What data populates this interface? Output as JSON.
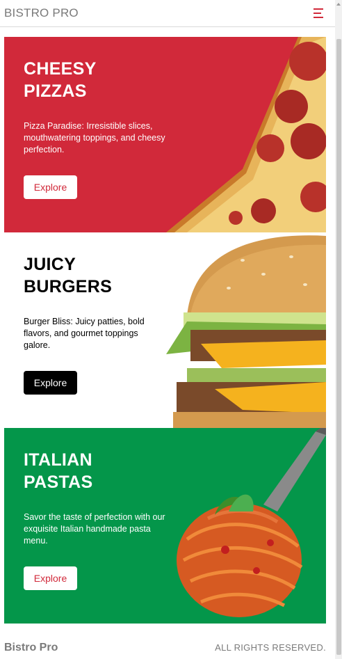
{
  "header": {
    "brand": "BISTRO PRO",
    "menu_icon": "hamburger-menu-icon"
  },
  "colors": {
    "brand_red": "#d1293a",
    "brand_green": "#04964a",
    "black": "#000000",
    "white": "#ffffff",
    "muted_text": "#7a7a7a"
  },
  "cards": [
    {
      "title_line1": "CHEESY",
      "title_line2": "PIZZAS",
      "description": "Pizza Paradise: Irresistible slices, mouthwatering toppings, and cheesy perfection.",
      "button_label": "Explore",
      "image": "pepperoni-pizza-slice"
    },
    {
      "title_line1": "JUICY",
      "title_line2": "BURGERS",
      "description": "Burger Bliss: Juicy patties, bold flavors, and gourmet toppings galore.",
      "button_label": "Explore",
      "image": "double-cheeseburger"
    },
    {
      "title_line1": "ITALIAN",
      "title_line2": "PASTAS",
      "description": "Savor the taste of perfection with our exquisite Italian handmade pasta menu.",
      "button_label": "Explore",
      "image": "spaghetti-on-fork"
    }
  ],
  "footer": {
    "brand": "Bistro Pro",
    "rights": "ALL RIGHTS RESERVED."
  }
}
